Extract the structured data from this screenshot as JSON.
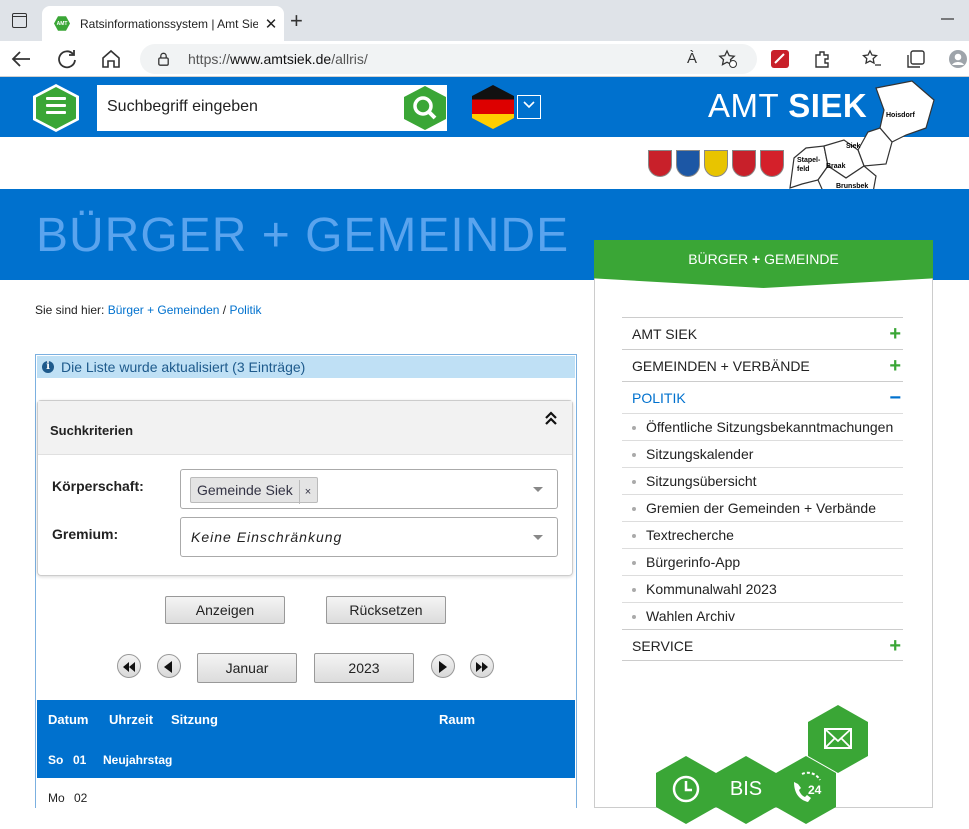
{
  "browser": {
    "tab_title": "Ratsinformationssystem | Amt Sie",
    "favicon_text": "AMT SIEK",
    "tab_close": "✕",
    "new_tab": "+",
    "url_prefix": "https://",
    "url_domain": "www.amtsiek.de",
    "url_path": "/allris/",
    "read_aloud": "À"
  },
  "header": {
    "search_placeholder": "Suchbegriff eingeben",
    "brand_light": "AMT ",
    "brand_bold": "SIEK",
    "map_labels": [
      "Hoisdorf",
      "Siek",
      "Stapel-",
      "feld",
      "Braak",
      "Brunsbek"
    ]
  },
  "hero": {
    "title": "BÜRGER + GEMEINDE"
  },
  "breadcrumb": {
    "prefix": "Sie sind hier:",
    "link1": "Bürger + Gemeinden",
    "sep": " / ",
    "link2": "Politik"
  },
  "notice": {
    "icon": "i",
    "text": "Die Liste wurde aktualisiert (3 Einträge)"
  },
  "criteria": {
    "title": "Suchkriterien",
    "collapse": "⌃",
    "koerperschaft_label": "Körperschaft:",
    "koerperschaft_value": "Gemeinde Siek",
    "chip_remove": "×",
    "gremium_label": "Gremium:",
    "gremium_value": "Keine Einschränkung"
  },
  "actions": {
    "show": "Anzeigen",
    "reset": "Rücksetzen"
  },
  "period": {
    "month": "Januar",
    "year": "2023"
  },
  "table": {
    "headers": {
      "date": "Datum",
      "time": "Uhrzeit",
      "meeting": "Sitzung",
      "room": "Raum"
    },
    "rows": [
      {
        "day": "So",
        "num": "01",
        "label": "Neujahrstag"
      },
      {
        "day": "Mo",
        "num": "02",
        "label": ""
      }
    ]
  },
  "sidebar": {
    "heading_a": "BÜRGER ",
    "heading_plus": "+",
    "heading_b": " GEMEINDE",
    "items": [
      {
        "label": "AMT SIEK",
        "toggle": "+"
      },
      {
        "label": "GEMEINDEN + VERBÄNDE",
        "toggle": "+"
      },
      {
        "label": "POLITIK",
        "toggle": "−"
      }
    ],
    "subitems": [
      "Öffentliche Sitzungsbekanntmachungen",
      "Sitzungskalender",
      "Sitzungsübersicht",
      "Gremien der Gemeinden + Verbände",
      "Textrecherche",
      "Bürgerinfo-App",
      "Kommunalwahl 2023",
      "Wahlen Archiv"
    ],
    "service": {
      "label": "SERVICE",
      "toggle": "+"
    }
  },
  "quicklinks": {
    "bis": "BIS",
    "hours": "24"
  },
  "colors": {
    "blue": "#0071ce",
    "green": "#3aa636"
  }
}
